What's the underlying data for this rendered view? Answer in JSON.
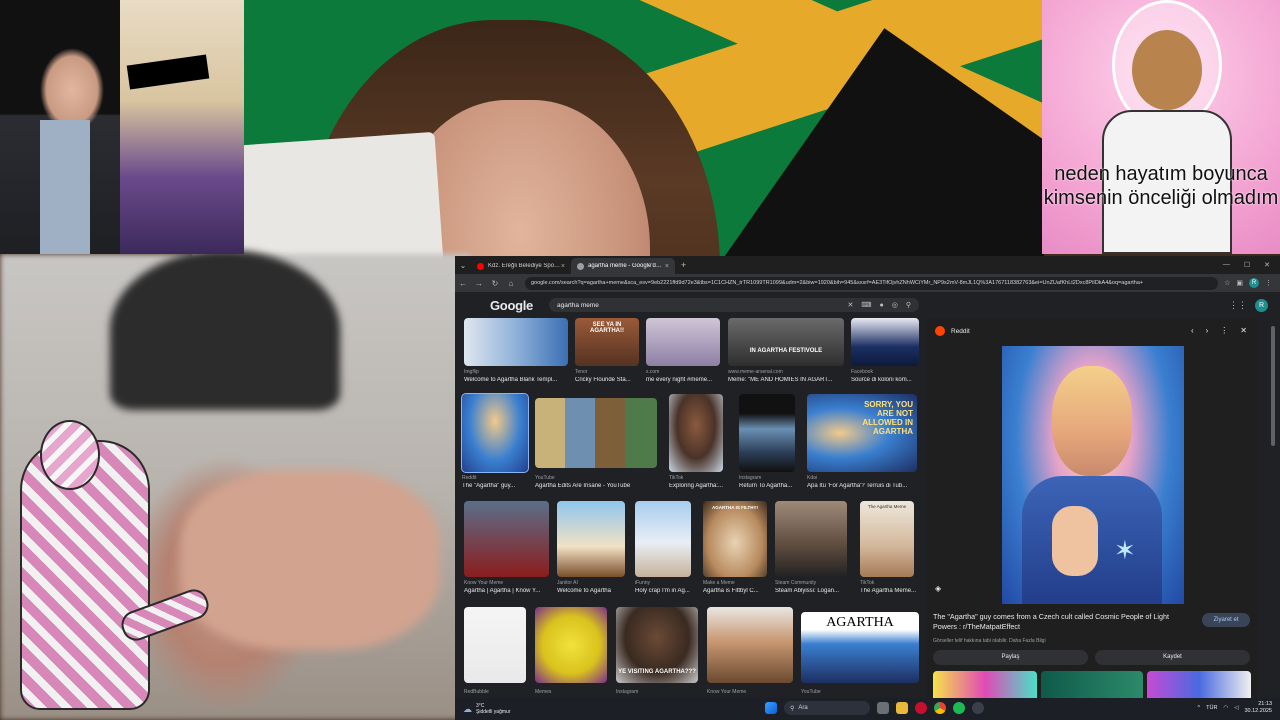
{
  "overlays": {
    "caption_top_right": "neden hayatım boyunca kimsenin önceliği olmadım"
  },
  "browser": {
    "tabs": [
      {
        "label": "Kdz. Ereğli Belediye Spor - Zon",
        "active": false,
        "favicon_color": "#ff0000"
      },
      {
        "label": "agartha meme - Google'da Ara",
        "active": true,
        "favicon_color": "#9aa0a6"
      }
    ],
    "new_tab_icon": "plus-icon",
    "url": "google.com/search?q=agartha+meme&sca_esv=9eb2221ffd9d72e3&tbs=1C1CHZN_trTR1099TR1099&udm=2&biw=1920&bih=945&sxsrf=AE3TifOjvhZNhWCiYMr_NP9s2mV-8mJL1Q%3A1767118382763&ei=UnZUafKhLt2Dxc8PiIDkA4&oq=agartha+",
    "profile_initial": "R"
  },
  "google": {
    "logo": "Google",
    "query": "agartha meme",
    "avatar_initial": "R"
  },
  "results": [
    {
      "src": "Imgflip",
      "caption": "Welcome to Agartha Blank Templ...",
      "thumb_text": ""
    },
    {
      "src": "Tenor",
      "caption": "Cricky Flouride Sta...",
      "thumb_text": "SEE YA IN AGARTHA!!"
    },
    {
      "src": "x.com",
      "caption": "me every night #meme...",
      "thumb_text": ""
    },
    {
      "src": "www.meme-arsenal.com",
      "caption": "Meme: \"ME AND HOMIES IN AGART...",
      "thumb_text": "IN AGARTHA FESTIVOLE"
    },
    {
      "src": "Facebook",
      "caption": "Source di koloni kom...",
      "thumb_text": ""
    },
    {
      "src": "Reddit",
      "caption": "The \"Agartha\" guy...",
      "thumb_text": ""
    },
    {
      "src": "YouTube",
      "caption": "Agartha Edits Are Insane - YouTube",
      "thumb_text": ""
    },
    {
      "src": "TikTok",
      "caption": "Exploring Agartha:...",
      "thumb_text": ""
    },
    {
      "src": "Instagram",
      "caption": "Return To Agartha...",
      "thumb_text": ""
    },
    {
      "src": "Kdai",
      "caption": "Apa Itu 'For Agartha'? Terruis di Tub...",
      "thumb_text": "SORRY, YOU ARE NOT ALLOWED IN AGARTHA"
    },
    {
      "src": "Know Your Meme",
      "caption": "Agartha | Agartha | Know Y...",
      "thumb_text": ""
    },
    {
      "src": "Janitor AI",
      "caption": "Welcome to Agartha",
      "thumb_text": ""
    },
    {
      "src": "iFunny",
      "caption": "Holy crap I'm in Ag...",
      "thumb_text": ""
    },
    {
      "src": "Make a Meme",
      "caption": "Agartha is Fittbyl C...",
      "thumb_text": "AGARTHA IS FILTHY!"
    },
    {
      "src": "Steam Community",
      "caption": "Steam Ablyissi: Logan...",
      "thumb_text": ""
    },
    {
      "src": "TikTok",
      "caption": "The Agartha Meme...",
      "thumb_text": "The Agartha Meme"
    },
    {
      "src": "RedBubble",
      "caption": "",
      "thumb_text": ""
    },
    {
      "src": "Memes",
      "caption": "",
      "thumb_text": ""
    },
    {
      "src": "Instagram",
      "caption": "",
      "thumb_text": "YE VISITING AGARTHA???"
    },
    {
      "src": "Know Your Meme",
      "caption": "",
      "thumb_text": ""
    },
    {
      "src": "YouTube",
      "caption": "",
      "thumb_text": "AGARTHA"
    }
  ],
  "panel": {
    "source": "Reddit",
    "title": "The \"Agartha\" guy comes from a Czech cult called Cosmic People of Light Powers : r/TheMatpatEffect",
    "visit_label": "Ziyaret et",
    "note": "Görseller telif hakkına tabi olabilir. Daha Fazla Bilgi",
    "share_label": "Paylaş",
    "save_label": "Kaydet"
  },
  "taskbar": {
    "temperature": "3°C",
    "weather_text": "Şiddetli yağmur",
    "search_placeholder": "Ara",
    "language": "TÜR",
    "time": "21:13",
    "date": "30.12.2025"
  }
}
